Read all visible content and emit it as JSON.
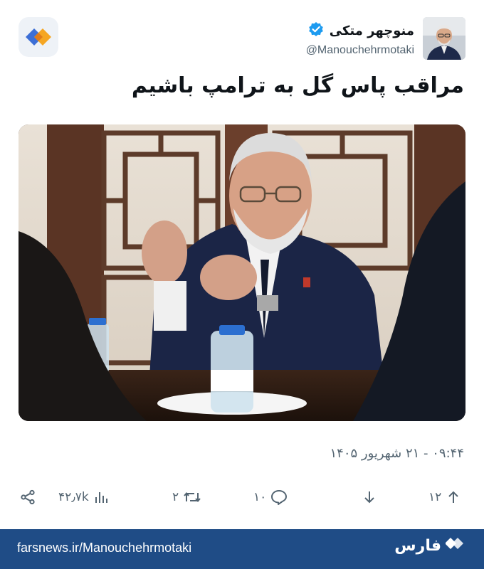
{
  "author": {
    "display_name": "منوچهر متکی",
    "handle": "@Manouchehrmotaki",
    "verified": true
  },
  "tweet": {
    "text": "مراقب پاس گل به ترامپ باشیم",
    "timestamp": "۰۹:۴۴ - ۲۱ شهریور ۱۴۰۵"
  },
  "stats": {
    "views": "۴۲٫۷k",
    "retweets": "۲",
    "replies": "۱۰",
    "likes": "۱۲"
  },
  "footer": {
    "url": "farsnews.ir/Manouchehrmotaki",
    "brand": "فارس"
  },
  "colors": {
    "footer_bg": "#1f4c86",
    "verified_badge": "#1d9bf0",
    "logo_blue": "#3d6fd6",
    "logo_orange": "#f5a623"
  },
  "icons": [
    "app-logo-icon",
    "verified-badge-icon",
    "share-icon",
    "views-icon",
    "retweet-icon",
    "reply-icon",
    "download-icon",
    "upvote-icon",
    "fars-logo-icon"
  ]
}
